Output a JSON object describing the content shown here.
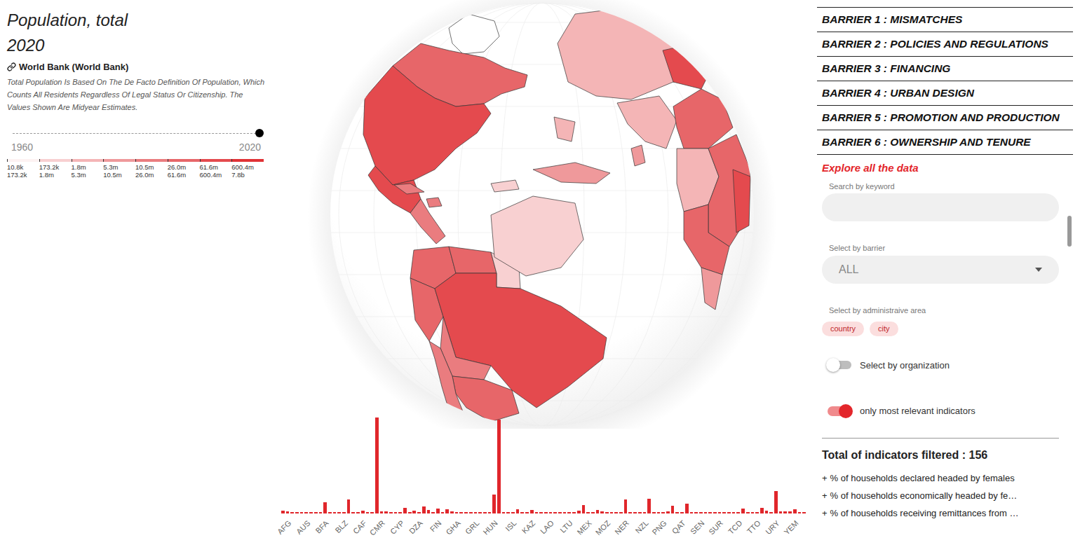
{
  "panel": {
    "title": "Population, total",
    "year": "2020",
    "source": "World Bank (World Bank)",
    "description": "Total Population Is Based On The De Facto Definition Of Population, Which Counts All Residents Regardless Of Legal Status Or Citizenship. The Values Shown Are Midyear Estimates.",
    "slider": {
      "start": "1960",
      "end": "2020",
      "level": 1
    },
    "legend": [
      {
        "from": "10.8k",
        "to": "173.2k",
        "color": "#fdf2f2"
      },
      {
        "from": "173.2k",
        "to": "1.8m",
        "color": "#f8d0d1"
      },
      {
        "from": "1.8m",
        "to": "5.3m",
        "color": "#f4b5b6"
      },
      {
        "from": "5.3m",
        "to": "10.5m",
        "color": "#ef999b"
      },
      {
        "from": "10.5m",
        "to": "26.0m",
        "color": "#ea7c7f"
      },
      {
        "from": "26.0m",
        "to": "61.6m",
        "color": "#e76669"
      },
      {
        "from": "61.6m",
        "to": "600.4m",
        "color": "#e44a4e"
      },
      {
        "from": "600.4m",
        "to": "7.8b",
        "color": "#e03236"
      }
    ]
  },
  "map": {
    "regions": [
      {
        "bin": null
      },
      {
        "bin": 5
      },
      {
        "bin": 6
      },
      {
        "bin": 6
      },
      {
        "bin": 4
      },
      {
        "bin": 4
      },
      {
        "bin": 4
      },
      {
        "bin": 5
      },
      {
        "bin": 5
      },
      {
        "bin": 1
      },
      {
        "bin": 5
      },
      {
        "bin": 6
      },
      {
        "bin": 4
      },
      {
        "bin": 5
      },
      {
        "bin": 4
      },
      {
        "bin": 2
      },
      {
        "bin": 2
      },
      {
        "bin": 2
      },
      {
        "bin": 3
      },
      {
        "bin": 3
      },
      {
        "bin": 1
      },
      {
        "bin": 1
      },
      {
        "bin": 6
      },
      {
        "bin": 5
      },
      {
        "bin": 2
      },
      {
        "bin": 5
      },
      {
        "bin": 6
      },
      {
        "bin": 5
      },
      {
        "bin": 3
      }
    ]
  },
  "chart": {
    "groups": [
      {
        "label": "AFG",
        "values": [
          38.9,
          28.0,
          2.8,
          9.9
        ]
      },
      {
        "label": "AUS",
        "values": [
          25.7,
          9.0,
          10.1,
          11.5
        ]
      },
      {
        "label": "BFA",
        "values": [
          20.9,
          164.7,
          6.9,
          2.9
        ]
      },
      {
        "label": "BLZ",
        "values": [
          0.4,
          11.9,
          211.0,
          0.4
        ]
      },
      {
        "label": "CAF",
        "values": [
          4.8,
          38.0,
          8.6,
          19.1
        ]
      },
      {
        "label": "CMR",
        "values": [
          1411.0,
          26.4,
          26.6,
          5.5
        ]
      },
      {
        "label": "CYP",
        "values": [
          1.2,
          10.7,
          83.2,
          5.8
        ]
      },
      {
        "label": "DZA",
        "values": [
          43.9,
          17.6,
          102.3,
          46.8
        ]
      },
      {
        "label": "FIN",
        "values": [
          5.5,
          67.4,
          2.2,
          67.1
        ]
      },
      {
        "label": "GHA",
        "values": [
          31.1,
          13.0,
          2.4,
          10.7
        ]
      },
      {
        "label": "GRL",
        "values": [
          0.06,
          16.9,
          0.8,
          9.9
        ]
      },
      {
        "label": "HUN",
        "values": [
          9.7,
          273.5,
          1380.0,
          5.0
        ]
      },
      {
        "label": "ISL",
        "values": [
          0.4,
          9.2,
          59.4,
          3.0
        ]
      },
      {
        "label": "KAZ",
        "values": [
          18.8,
          53.8,
          6.6,
          16.7
        ]
      },
      {
        "label": "LAO",
        "values": [
          7.3,
          6.8,
          5.1,
          0.04
        ]
      },
      {
        "label": "LTU",
        "values": [
          2.8,
          0.6,
          1.9,
          36.9
        ]
      },
      {
        "label": "MEX",
        "values": [
          128.9,
          2.1,
          20.3,
          54.4
        ]
      },
      {
        "label": "MOZ",
        "values": [
          31.3,
          2.5,
          4.6,
          19.1
        ]
      },
      {
        "label": "NER",
        "values": [
          24.2,
          206.1,
          6.6,
          17.4
        ]
      },
      {
        "label": "NZL",
        "values": [
          5.1,
          5.1,
          220.9,
          4.3
        ]
      },
      {
        "label": "PNG",
        "values": [
          8.9,
          7.1,
          32.9,
          109.6
        ]
      },
      {
        "label": "QAT",
        "values": [
          2.9,
          19.3,
          144.1,
          12.9
        ]
      },
      {
        "label": "SEN",
        "values": [
          16.7,
          5.7,
          8.0,
          6.9
        ]
      },
      {
        "label": "SUR",
        "values": [
          0.6,
          5.5,
          2.1,
          10.4
        ]
      },
      {
        "label": "TCD",
        "values": [
          16.4,
          8.3,
          69.8,
          9.5
        ]
      },
      {
        "label": "TTO",
        "values": [
          1.4,
          11.8,
          84.3,
          45.7
        ]
      },
      {
        "label": "URY",
        "values": [
          3.5,
          331.5,
          34.2,
          29.1
        ]
      },
      {
        "label": "YEM",
        "values": [
          29.8,
          59.3,
          18.4,
          14.9
        ]
      }
    ]
  },
  "sidebar": {
    "barriers": [
      "BARRIER 1 : MISMATCHES",
      "BARRIER 2 : POLICIES AND REGULATIONS",
      "BARRIER 3 : FINANCING",
      "BARRIER 4 : URBAN DESIGN",
      "BARRIER 5 : PROMOTION AND PRODUCTION",
      "BARRIER 6 : OWNERSHIP AND TENURE"
    ],
    "explore_title": "Explore all the data",
    "search": {
      "label": "Search by keyword",
      "value": ""
    },
    "barrier_select": {
      "label": "Select by barrier",
      "value": "ALL"
    },
    "admin_area": {
      "label": "Select by administraive area",
      "chips": [
        {
          "label": "country",
          "selected": false
        },
        {
          "label": "city",
          "selected": false
        }
      ]
    },
    "toggles": [
      {
        "label": "Select by organization",
        "on": false
      },
      {
        "label": "only most relevant indicators",
        "on": true
      }
    ],
    "total": "Total of indicators filtered : 156",
    "indicators": [
      {
        "icon": "+",
        "label": "% of households declared headed by females"
      },
      {
        "icon": "+",
        "label": "% of households economically headed by fe…"
      },
      {
        "icon": "+",
        "label": "% of households receiving remittances from …"
      }
    ]
  }
}
